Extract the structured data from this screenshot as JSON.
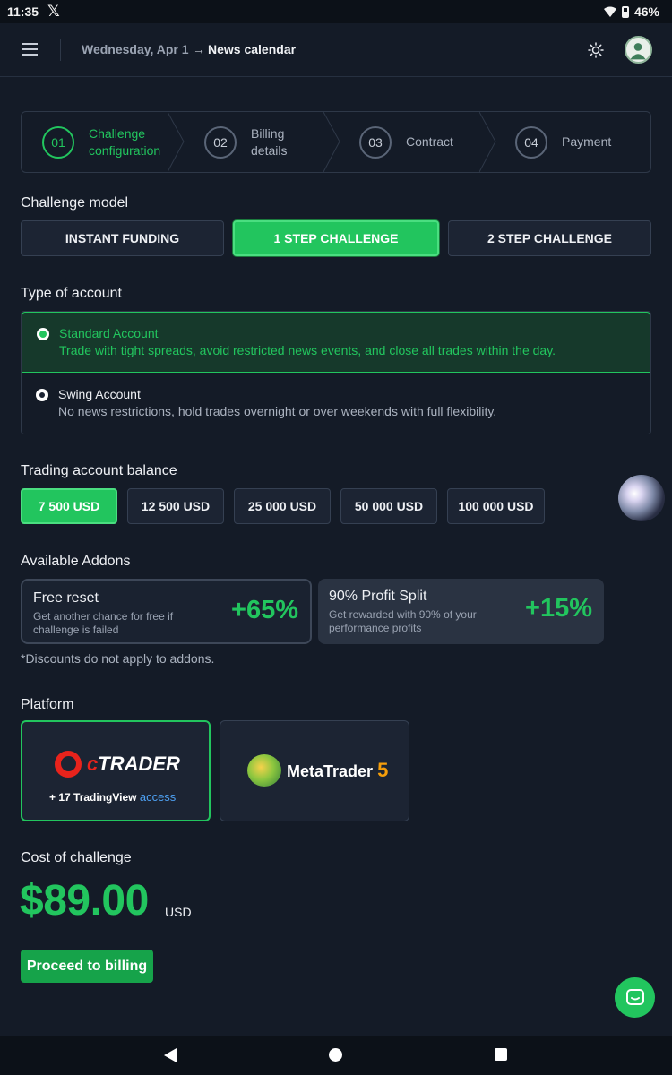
{
  "status_bar": {
    "time": "11:35",
    "app_icon": "x-icon",
    "battery": "46%"
  },
  "header": {
    "date": "Wednesday, Apr 1",
    "arrow": "→",
    "news_link": "News calendar"
  },
  "stepper": {
    "steps": [
      {
        "num": "01",
        "line1": "Challenge",
        "line2": "configuration",
        "active": true
      },
      {
        "num": "02",
        "line1": "Billing",
        "line2": "details",
        "active": false
      },
      {
        "num": "03",
        "line1": "Contract",
        "line2": "",
        "active": false
      },
      {
        "num": "04",
        "line1": "Payment",
        "line2": "",
        "active": false
      }
    ]
  },
  "challenge_model": {
    "title": "Challenge model",
    "options": [
      "INSTANT FUNDING",
      "1 STEP CHALLENGE",
      "2 STEP CHALLENGE"
    ],
    "selected": "1 STEP CHALLENGE"
  },
  "account_type": {
    "title": "Type of account",
    "options": [
      {
        "title": "Standard Account",
        "desc": "Trade with tight spreads, avoid restricted news events, and close all trades within the day."
      },
      {
        "title": "Swing Account",
        "desc": "No news restrictions, hold trades overnight or over weekends with full flexibility."
      }
    ],
    "selected": "Standard Account"
  },
  "balance": {
    "title": "Trading account balance",
    "options": [
      "7 500 USD",
      "12 500 USD",
      "25 000 USD",
      "50 000 USD",
      "100 000 USD"
    ],
    "selected": "7 500 USD"
  },
  "addons": {
    "title": "Available Addons",
    "items": [
      {
        "title": "Free reset",
        "desc": "Get another chance for free if challenge is failed",
        "percent": "+65%"
      },
      {
        "title": "90% Profit Split",
        "desc": "Get rewarded with 90% of your performance profits",
        "percent": "+15%"
      }
    ],
    "note": "*Discounts do not apply to addons."
  },
  "platform": {
    "title": "Platform",
    "ctrader": {
      "logo_c": "c",
      "logo_rest": "TRADER",
      "tv_prefix": "+ ",
      "tv_name": "TradingView",
      "tv_access": "access"
    },
    "metatrader": {
      "name": "MetaTrader",
      "version": "5"
    },
    "selected": "cTrader"
  },
  "cost": {
    "title": "Cost of challenge",
    "amount": "$89.00",
    "currency": "USD"
  },
  "proceed_label": "Proceed to billing",
  "colors": {
    "accent": "#22c55e",
    "background": "#141b27",
    "panel": "#1c2433"
  }
}
